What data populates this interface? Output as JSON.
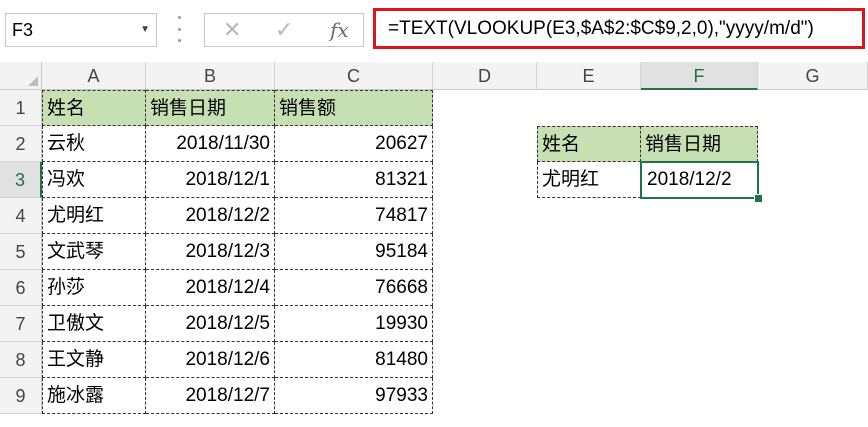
{
  "name_box": {
    "value": "F3",
    "dropdown_icon": "chevron-down-icon"
  },
  "formula_buttons": {
    "cancel_icon": "close-icon",
    "enter_icon": "check-icon",
    "fx_label": "fx"
  },
  "formula": "=TEXT(VLOOKUP(E3,$A$2:$C$9,2,0),\"yyyy/m/d\")",
  "colors": {
    "header_fill": "#c6e0b4",
    "active_border": "#217346",
    "formula_highlight": "#e0141e"
  },
  "columns": [
    "A",
    "B",
    "C",
    "D",
    "E",
    "F",
    "G"
  ],
  "rows": [
    "1",
    "2",
    "3",
    "4",
    "5",
    "6",
    "7",
    "8",
    "9"
  ],
  "table": {
    "headers": [
      "姓名",
      "销售日期",
      "销售额"
    ],
    "rows": [
      [
        "云秋",
        "2018/11/30",
        "20627"
      ],
      [
        "冯欢",
        "2018/12/1",
        "81321"
      ],
      [
        "尤明红",
        "2018/12/2",
        "74817"
      ],
      [
        "文武琴",
        "2018/12/3",
        "95184"
      ],
      [
        "孙莎",
        "2018/12/4",
        "76668"
      ],
      [
        "卫傲文",
        "2018/12/5",
        "19930"
      ],
      [
        "王文静",
        "2018/12/6",
        "81480"
      ],
      [
        "施冰露",
        "2018/12/7",
        "97933"
      ]
    ]
  },
  "lookup": {
    "headers": [
      "姓名",
      "销售日期"
    ],
    "name": "尤明红",
    "result": "2018/12/2"
  }
}
